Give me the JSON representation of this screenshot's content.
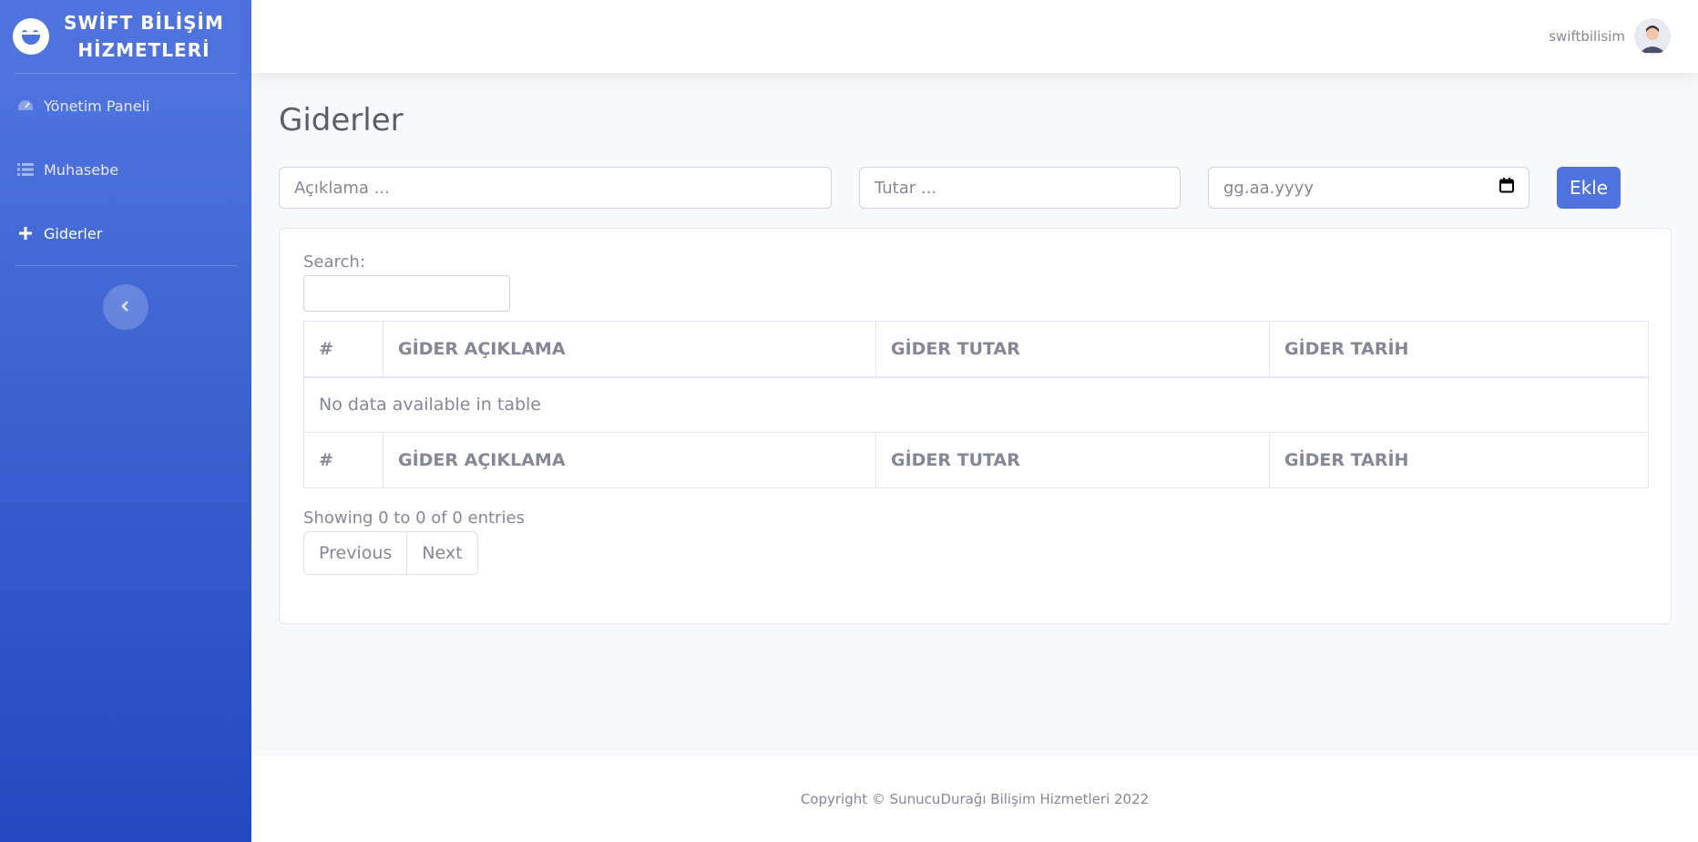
{
  "brand": {
    "name": "SWİFT BİLİŞİM HİZMETLERİ",
    "logo_icon": "laughing-face-icon"
  },
  "sidebar": {
    "items": [
      {
        "label": "Yönetim Paneli",
        "icon": "tachometer-icon",
        "active": false
      },
      {
        "label": "Muhasebe",
        "icon": "list-icon",
        "active": false
      },
      {
        "label": "Giderler",
        "icon": "plus-icon",
        "active": true
      }
    ],
    "toggle_icon": "chevron-left-icon"
  },
  "topbar": {
    "username": "swiftbilisim"
  },
  "page": {
    "title": "Giderler"
  },
  "form": {
    "description_placeholder": "Açıklama ...",
    "amount_placeholder": "Tutar ...",
    "date_placeholder": "gg.aa.yyyy",
    "submit_label": "Ekle"
  },
  "table": {
    "search_label": "Search:",
    "columns": [
      "#",
      "GİDER AÇIKLAMA",
      "GİDER TUTAR",
      "GİDER TARİH"
    ],
    "empty_message": "No data available in table",
    "info": "Showing 0 to 0 of 0 entries",
    "prev_label": "Previous",
    "next_label": "Next"
  },
  "footer": {
    "copyright": "Copyright © SunucuDurağı Bilişim Hizmetleri 2022"
  },
  "colors": {
    "primary": "#4e73df",
    "primary_dark": "#224abe",
    "text_muted": "#858796"
  }
}
